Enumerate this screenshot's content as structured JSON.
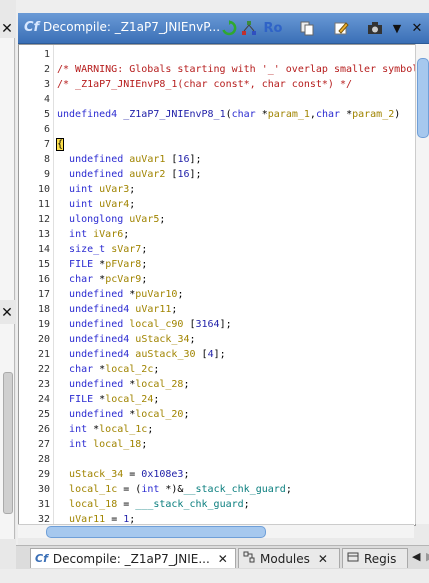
{
  "window": {
    "title": "Decompile: _Z1aP7_JNIEnvP...",
    "icon_glyph": "Cf",
    "toolbar": {
      "refresh_icon": "refresh-icon",
      "graph_icon": "graph-icon",
      "ro_label": "Ro",
      "copy_icon": "copy-icon",
      "edit_icon": "edit-icon",
      "snapshot_icon": "snapshot-icon",
      "menu_icon": "dropdown-menu-icon",
      "close_label": "✕"
    }
  },
  "left_panels": {
    "close_label": "✕"
  },
  "code": {
    "lines": [
      {
        "n": "1",
        "parts": []
      },
      {
        "n": "2",
        "parts": [
          [
            "com",
            "/* WARNING: Globals starting with '_' overlap smaller symbol"
          ]
        ]
      },
      {
        "n": "3",
        "parts": [
          [
            "com",
            "/* _Z1aP7_JNIEnvP8_1(char const*, char const*) */"
          ]
        ]
      },
      {
        "n": "4",
        "parts": []
      },
      {
        "n": "5",
        "parts": [
          [
            "kw",
            "undefined4 "
          ],
          [
            "fn",
            "_Z1aP7_JNIEnvP8_1"
          ],
          [
            "txt",
            "("
          ],
          [
            "kw",
            "char"
          ],
          [
            "txt",
            " *"
          ],
          [
            "var",
            "param_1"
          ],
          [
            "txt",
            ","
          ],
          [
            "kw",
            "char"
          ],
          [
            "txt",
            " *"
          ],
          [
            "var",
            "param_2"
          ],
          [
            "txt",
            ")"
          ]
        ]
      },
      {
        "n": "6",
        "parts": []
      },
      {
        "n": "7",
        "parts": [
          [
            "brace",
            "{"
          ]
        ]
      },
      {
        "n": "8",
        "parts": [
          [
            "txt",
            "  "
          ],
          [
            "kw",
            "undefined"
          ],
          [
            "txt",
            " "
          ],
          [
            "var",
            "auVar1"
          ],
          [
            "txt",
            " ["
          ],
          [
            "num",
            "16"
          ],
          [
            "txt",
            "];"
          ]
        ]
      },
      {
        "n": "9",
        "parts": [
          [
            "txt",
            "  "
          ],
          [
            "kw",
            "undefined"
          ],
          [
            "txt",
            " "
          ],
          [
            "var",
            "auVar2"
          ],
          [
            "txt",
            " ["
          ],
          [
            "num",
            "16"
          ],
          [
            "txt",
            "];"
          ]
        ]
      },
      {
        "n": "10",
        "parts": [
          [
            "txt",
            "  "
          ],
          [
            "kw",
            "uint"
          ],
          [
            "txt",
            " "
          ],
          [
            "var",
            "uVar3"
          ],
          [
            "txt",
            ";"
          ]
        ]
      },
      {
        "n": "11",
        "parts": [
          [
            "txt",
            "  "
          ],
          [
            "kw",
            "uint"
          ],
          [
            "txt",
            " "
          ],
          [
            "var",
            "uVar4"
          ],
          [
            "txt",
            ";"
          ]
        ]
      },
      {
        "n": "12",
        "parts": [
          [
            "txt",
            "  "
          ],
          [
            "kw",
            "ulonglong"
          ],
          [
            "txt",
            " "
          ],
          [
            "var",
            "uVar5"
          ],
          [
            "txt",
            ";"
          ]
        ]
      },
      {
        "n": "13",
        "parts": [
          [
            "txt",
            "  "
          ],
          [
            "kw",
            "int"
          ],
          [
            "txt",
            " "
          ],
          [
            "var",
            "iVar6"
          ],
          [
            "txt",
            ";"
          ]
        ]
      },
      {
        "n": "14",
        "parts": [
          [
            "txt",
            "  "
          ],
          [
            "kw",
            "size_t"
          ],
          [
            "txt",
            " "
          ],
          [
            "var",
            "sVar7"
          ],
          [
            "txt",
            ";"
          ]
        ]
      },
      {
        "n": "15",
        "parts": [
          [
            "txt",
            "  "
          ],
          [
            "kw",
            "FILE"
          ],
          [
            "txt",
            " *"
          ],
          [
            "var",
            "pFVar8"
          ],
          [
            "txt",
            ";"
          ]
        ]
      },
      {
        "n": "16",
        "parts": [
          [
            "txt",
            "  "
          ],
          [
            "kw",
            "char"
          ],
          [
            "txt",
            " *"
          ],
          [
            "var",
            "pcVar9"
          ],
          [
            "txt",
            ";"
          ]
        ]
      },
      {
        "n": "17",
        "parts": [
          [
            "txt",
            "  "
          ],
          [
            "kw",
            "undefined"
          ],
          [
            "txt",
            " *"
          ],
          [
            "var",
            "puVar10"
          ],
          [
            "txt",
            ";"
          ]
        ]
      },
      {
        "n": "18",
        "parts": [
          [
            "txt",
            "  "
          ],
          [
            "kw",
            "undefined4"
          ],
          [
            "txt",
            " "
          ],
          [
            "var",
            "uVar11"
          ],
          [
            "txt",
            ";"
          ]
        ]
      },
      {
        "n": "19",
        "parts": [
          [
            "txt",
            "  "
          ],
          [
            "kw",
            "undefined"
          ],
          [
            "txt",
            " "
          ],
          [
            "var",
            "local_c90"
          ],
          [
            "txt",
            " ["
          ],
          [
            "num",
            "3164"
          ],
          [
            "txt",
            "];"
          ]
        ]
      },
      {
        "n": "20",
        "parts": [
          [
            "txt",
            "  "
          ],
          [
            "kw",
            "undefined4"
          ],
          [
            "txt",
            " "
          ],
          [
            "var",
            "uStack_34"
          ],
          [
            "txt",
            ";"
          ]
        ]
      },
      {
        "n": "21",
        "parts": [
          [
            "txt",
            "  "
          ],
          [
            "kw",
            "undefined4"
          ],
          [
            "txt",
            " "
          ],
          [
            "var",
            "auStack_30"
          ],
          [
            "txt",
            " ["
          ],
          [
            "num",
            "4"
          ],
          [
            "txt",
            "];"
          ]
        ]
      },
      {
        "n": "22",
        "parts": [
          [
            "txt",
            "  "
          ],
          [
            "kw",
            "char"
          ],
          [
            "txt",
            " *"
          ],
          [
            "var",
            "local_2c"
          ],
          [
            "txt",
            ";"
          ]
        ]
      },
      {
        "n": "23",
        "parts": [
          [
            "txt",
            "  "
          ],
          [
            "kw",
            "undefined"
          ],
          [
            "txt",
            " *"
          ],
          [
            "var",
            "local_28"
          ],
          [
            "txt",
            ";"
          ]
        ]
      },
      {
        "n": "24",
        "parts": [
          [
            "txt",
            "  "
          ],
          [
            "kw",
            "FILE"
          ],
          [
            "txt",
            " *"
          ],
          [
            "var",
            "local_24"
          ],
          [
            "txt",
            ";"
          ]
        ]
      },
      {
        "n": "25",
        "parts": [
          [
            "txt",
            "  "
          ],
          [
            "kw",
            "undefined"
          ],
          [
            "txt",
            " *"
          ],
          [
            "var",
            "local_20"
          ],
          [
            "txt",
            ";"
          ]
        ]
      },
      {
        "n": "26",
        "parts": [
          [
            "txt",
            "  "
          ],
          [
            "kw",
            "int"
          ],
          [
            "txt",
            " *"
          ],
          [
            "var",
            "local_1c"
          ],
          [
            "txt",
            ";"
          ]
        ]
      },
      {
        "n": "27",
        "parts": [
          [
            "txt",
            "  "
          ],
          [
            "kw",
            "int"
          ],
          [
            "txt",
            " "
          ],
          [
            "var",
            "local_18"
          ],
          [
            "txt",
            ";"
          ]
        ]
      },
      {
        "n": "28",
        "parts": []
      },
      {
        "n": "29",
        "parts": [
          [
            "txt",
            "  "
          ],
          [
            "var",
            "uStack_34"
          ],
          [
            "txt",
            " = "
          ],
          [
            "num",
            "0x108e3"
          ],
          [
            "txt",
            ";"
          ]
        ]
      },
      {
        "n": "30",
        "parts": [
          [
            "txt",
            "  "
          ],
          [
            "var",
            "local_1c"
          ],
          [
            "txt",
            " = ("
          ],
          [
            "kw",
            "int"
          ],
          [
            "txt",
            " *)&"
          ],
          [
            "glob",
            "__stack_chk_guard"
          ],
          [
            "txt",
            ";"
          ]
        ]
      },
      {
        "n": "31",
        "parts": [
          [
            "txt",
            "  "
          ],
          [
            "var",
            "local_18"
          ],
          [
            "txt",
            " = "
          ],
          [
            "glob",
            "___stack_chk_guard"
          ],
          [
            "txt",
            ";"
          ]
        ]
      },
      {
        "n": "32",
        "parts": [
          [
            "txt",
            "  "
          ],
          [
            "var",
            "uVar11"
          ],
          [
            "txt",
            " = "
          ],
          [
            "num",
            "1"
          ],
          [
            "txt",
            ";"
          ]
        ]
      }
    ]
  },
  "tabs": [
    {
      "label": "Decompile: _Z1aP7_JNIE...",
      "icon": "decompiler-icon",
      "close": "✕",
      "active": true
    },
    {
      "label": "Modules",
      "icon": "modules-icon",
      "close": "✕",
      "active": false
    },
    {
      "label": "Regis",
      "icon": "registers-icon",
      "close": "",
      "active": false
    }
  ],
  "colors": {
    "keyword": "#2b2bd1",
    "variable": "#a08400",
    "global": "#0a7e7e",
    "comment": "#b61d1d",
    "title_bar": "#3a6fb6"
  }
}
